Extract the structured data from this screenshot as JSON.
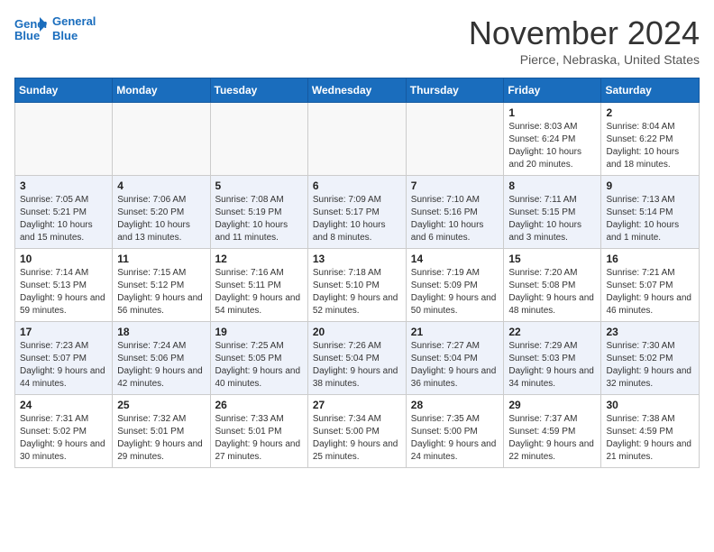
{
  "header": {
    "logo_line1": "General",
    "logo_line2": "Blue",
    "month": "November 2024",
    "location": "Pierce, Nebraska, United States"
  },
  "weekdays": [
    "Sunday",
    "Monday",
    "Tuesday",
    "Wednesday",
    "Thursday",
    "Friday",
    "Saturday"
  ],
  "weeks": [
    [
      {
        "day": "",
        "info": ""
      },
      {
        "day": "",
        "info": ""
      },
      {
        "day": "",
        "info": ""
      },
      {
        "day": "",
        "info": ""
      },
      {
        "day": "",
        "info": ""
      },
      {
        "day": "1",
        "info": "Sunrise: 8:03 AM\nSunset: 6:24 PM\nDaylight: 10 hours and 20 minutes."
      },
      {
        "day": "2",
        "info": "Sunrise: 8:04 AM\nSunset: 6:22 PM\nDaylight: 10 hours and 18 minutes."
      }
    ],
    [
      {
        "day": "3",
        "info": "Sunrise: 7:05 AM\nSunset: 5:21 PM\nDaylight: 10 hours and 15 minutes."
      },
      {
        "day": "4",
        "info": "Sunrise: 7:06 AM\nSunset: 5:20 PM\nDaylight: 10 hours and 13 minutes."
      },
      {
        "day": "5",
        "info": "Sunrise: 7:08 AM\nSunset: 5:19 PM\nDaylight: 10 hours and 11 minutes."
      },
      {
        "day": "6",
        "info": "Sunrise: 7:09 AM\nSunset: 5:17 PM\nDaylight: 10 hours and 8 minutes."
      },
      {
        "day": "7",
        "info": "Sunrise: 7:10 AM\nSunset: 5:16 PM\nDaylight: 10 hours and 6 minutes."
      },
      {
        "day": "8",
        "info": "Sunrise: 7:11 AM\nSunset: 5:15 PM\nDaylight: 10 hours and 3 minutes."
      },
      {
        "day": "9",
        "info": "Sunrise: 7:13 AM\nSunset: 5:14 PM\nDaylight: 10 hours and 1 minute."
      }
    ],
    [
      {
        "day": "10",
        "info": "Sunrise: 7:14 AM\nSunset: 5:13 PM\nDaylight: 9 hours and 59 minutes."
      },
      {
        "day": "11",
        "info": "Sunrise: 7:15 AM\nSunset: 5:12 PM\nDaylight: 9 hours and 56 minutes."
      },
      {
        "day": "12",
        "info": "Sunrise: 7:16 AM\nSunset: 5:11 PM\nDaylight: 9 hours and 54 minutes."
      },
      {
        "day": "13",
        "info": "Sunrise: 7:18 AM\nSunset: 5:10 PM\nDaylight: 9 hours and 52 minutes."
      },
      {
        "day": "14",
        "info": "Sunrise: 7:19 AM\nSunset: 5:09 PM\nDaylight: 9 hours and 50 minutes."
      },
      {
        "day": "15",
        "info": "Sunrise: 7:20 AM\nSunset: 5:08 PM\nDaylight: 9 hours and 48 minutes."
      },
      {
        "day": "16",
        "info": "Sunrise: 7:21 AM\nSunset: 5:07 PM\nDaylight: 9 hours and 46 minutes."
      }
    ],
    [
      {
        "day": "17",
        "info": "Sunrise: 7:23 AM\nSunset: 5:07 PM\nDaylight: 9 hours and 44 minutes."
      },
      {
        "day": "18",
        "info": "Sunrise: 7:24 AM\nSunset: 5:06 PM\nDaylight: 9 hours and 42 minutes."
      },
      {
        "day": "19",
        "info": "Sunrise: 7:25 AM\nSunset: 5:05 PM\nDaylight: 9 hours and 40 minutes."
      },
      {
        "day": "20",
        "info": "Sunrise: 7:26 AM\nSunset: 5:04 PM\nDaylight: 9 hours and 38 minutes."
      },
      {
        "day": "21",
        "info": "Sunrise: 7:27 AM\nSunset: 5:04 PM\nDaylight: 9 hours and 36 minutes."
      },
      {
        "day": "22",
        "info": "Sunrise: 7:29 AM\nSunset: 5:03 PM\nDaylight: 9 hours and 34 minutes."
      },
      {
        "day": "23",
        "info": "Sunrise: 7:30 AM\nSunset: 5:02 PM\nDaylight: 9 hours and 32 minutes."
      }
    ],
    [
      {
        "day": "24",
        "info": "Sunrise: 7:31 AM\nSunset: 5:02 PM\nDaylight: 9 hours and 30 minutes."
      },
      {
        "day": "25",
        "info": "Sunrise: 7:32 AM\nSunset: 5:01 PM\nDaylight: 9 hours and 29 minutes."
      },
      {
        "day": "26",
        "info": "Sunrise: 7:33 AM\nSunset: 5:01 PM\nDaylight: 9 hours and 27 minutes."
      },
      {
        "day": "27",
        "info": "Sunrise: 7:34 AM\nSunset: 5:00 PM\nDaylight: 9 hours and 25 minutes."
      },
      {
        "day": "28",
        "info": "Sunrise: 7:35 AM\nSunset: 5:00 PM\nDaylight: 9 hours and 24 minutes."
      },
      {
        "day": "29",
        "info": "Sunrise: 7:37 AM\nSunset: 4:59 PM\nDaylight: 9 hours and 22 minutes."
      },
      {
        "day": "30",
        "info": "Sunrise: 7:38 AM\nSunset: 4:59 PM\nDaylight: 9 hours and 21 minutes."
      }
    ]
  ]
}
